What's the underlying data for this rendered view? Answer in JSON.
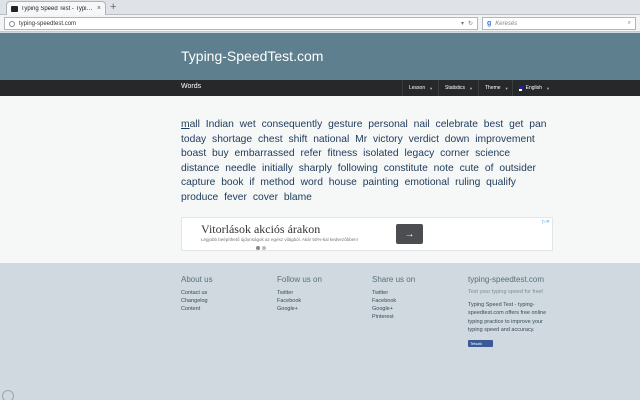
{
  "browser": {
    "tab_title": "Typing Speed Test - Typin...",
    "tab_close": "×",
    "new_tab": "+",
    "url": "typing-speedtest.com",
    "search_placeholder": "Keresés"
  },
  "header": {
    "site_title": "Typing-SpeedTest.com"
  },
  "navbar": {
    "words_label": "Words",
    "items": [
      {
        "label": "Lesson"
      },
      {
        "label": "Statistics"
      },
      {
        "label": "Theme"
      },
      {
        "label": "English"
      }
    ]
  },
  "test": {
    "current_word_typed": "m",
    "current_word_rest": "all",
    "remaining_text": "Indian wet consequently gesture personal nail celebrate best get pan today shortage chest shift national Mr victory verdict down improvement boast buy embarrassed refer fitness isolated legacy corner science distance needle initially sharply following constitute note cute of outsider capture book if method word house painting emotional ruling qualify produce fever cover blame"
  },
  "ad": {
    "title": "Vitorlások akciós árakon",
    "subtitle": "Legjobb beépíthető újdonságok az egész világból. Akár 50%-kal kedvezőbben!",
    "button_icon": "arrow-right-icon",
    "corner": "▷✕"
  },
  "footer": {
    "about": {
      "heading": "About us",
      "links": [
        "Contact us",
        "Changelog",
        "Content"
      ]
    },
    "follow": {
      "heading": "Follow us on",
      "links": [
        "Twitter",
        "Facebook",
        "Google+"
      ]
    },
    "share": {
      "heading": "Share us on",
      "links": [
        "Twitter",
        "Facebook",
        "Google+",
        "Pinterest"
      ]
    },
    "site": {
      "heading": "typing-speedtest.com",
      "tagline": "Test your typing speed for free!",
      "description": "Typing Speed Test - typing-speedtest.com offers free online typing practice to improve your typing speed and accuracy.",
      "fb_label": "Tetszik"
    }
  }
}
